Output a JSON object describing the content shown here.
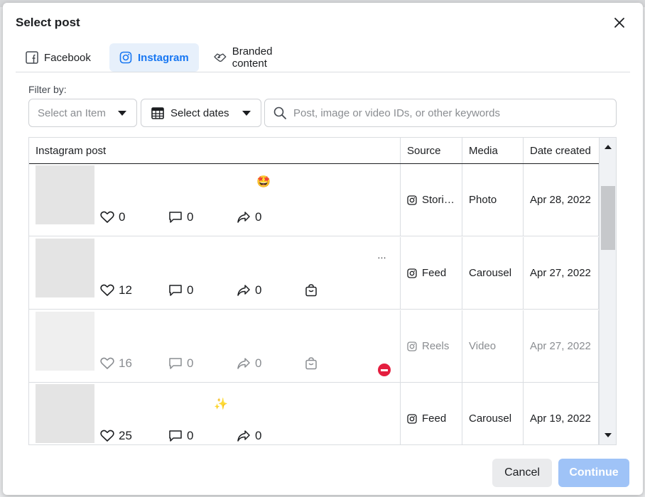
{
  "dialog": {
    "title": "Select post",
    "close_icon": "close-icon"
  },
  "tabs": [
    {
      "label": "Facebook",
      "icon": "facebook-icon",
      "active": false
    },
    {
      "label": "Instagram",
      "icon": "instagram-icon",
      "active": true
    },
    {
      "label": "Branded content",
      "icon": "handshake-icon",
      "active": false
    }
  ],
  "filters": {
    "label": "Filter by:",
    "item_placeholder": "Select an Item",
    "dates_label": "Select dates",
    "search_placeholder": "Post, image or video IDs, or other keywords"
  },
  "table": {
    "columns": [
      "Instagram post",
      "Source",
      "Media",
      "Date created"
    ],
    "rows": [
      {
        "likes": "0",
        "comments": "0",
        "shares": "0",
        "caption_emoji": "🤩",
        "source": "Stori…",
        "media": "Photo",
        "date": "Apr 28, 2022",
        "shopping": false,
        "disabled": false
      },
      {
        "likes": "12",
        "comments": "0",
        "shares": "0",
        "caption_emoji": "…",
        "source": "Feed",
        "media": "Carousel",
        "date": "Apr 27, 2022",
        "shopping": true,
        "disabled": false
      },
      {
        "likes": "16",
        "comments": "0",
        "shares": "0",
        "caption_emoji": "",
        "source": "Reels",
        "media": "Video",
        "date": "Apr 27, 2022",
        "shopping": true,
        "disabled": true
      },
      {
        "likes": "25",
        "comments": "0",
        "shares": "0",
        "caption_emoji": "✨",
        "source": "Feed",
        "media": "Carousel",
        "date": "Apr 19, 2022",
        "shopping": false,
        "disabled": false
      }
    ]
  },
  "footer": {
    "cancel_label": "Cancel",
    "continue_label": "Continue"
  },
  "colors": {
    "accent": "#1877f2",
    "continue_disabled": "#9fc3f7",
    "blocked": "#e41e3f"
  }
}
